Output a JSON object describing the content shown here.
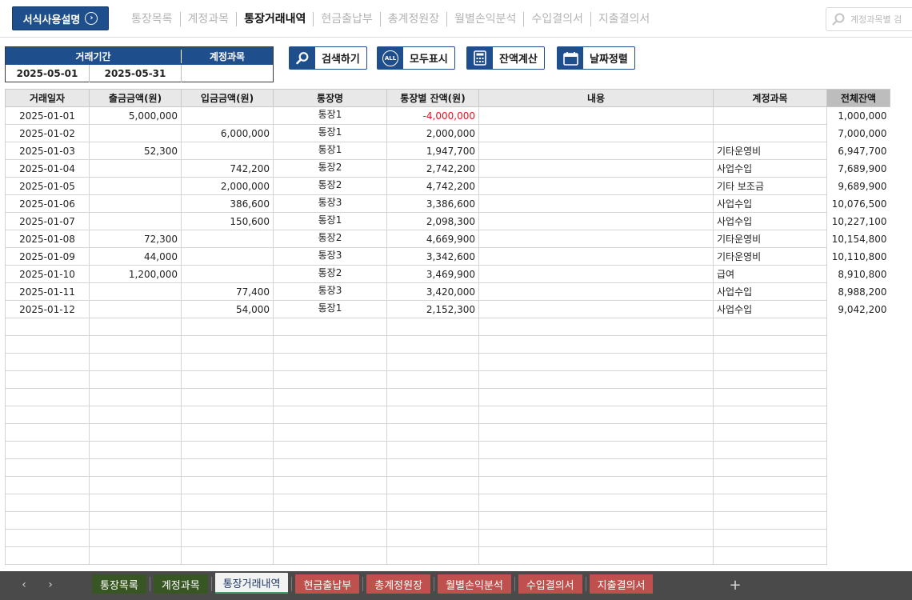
{
  "header": {
    "guide_button": "서식사용설명",
    "nav": [
      {
        "label": "통장목록",
        "active": false
      },
      {
        "label": "계정과목",
        "active": false
      },
      {
        "label": "통장거래내역",
        "active": true
      },
      {
        "label": "현금출납부",
        "active": false
      },
      {
        "label": "총계정원장",
        "active": false
      },
      {
        "label": "월별손익분석",
        "active": false
      },
      {
        "label": "수입결의서",
        "active": false
      },
      {
        "label": "지출결의서",
        "active": false
      }
    ],
    "search": {
      "placeholder": "계정과목별 검"
    }
  },
  "filter": {
    "period_label": "거래기간",
    "account_label": "계정과목",
    "start_date": "2025-05-01",
    "end_date": "2025-05-31",
    "account_value": ""
  },
  "actions": {
    "search": "검색하기",
    "show_all": "모두표시",
    "show_all_icon_text": "ALL",
    "balance": "잔액계산",
    "sort_date": "날짜정렬"
  },
  "table": {
    "columns": [
      "거래일자",
      "출금금액(원)",
      "입금금액(원)",
      "통장명",
      "통장별 잔액(원)",
      "내용",
      "계정과목",
      "전체잔액"
    ],
    "rows": [
      {
        "date": "2025-01-01",
        "out": "5,000,000",
        "in": "",
        "account": "통장1",
        "balance": "-4,000,000",
        "memo": "",
        "category": "",
        "total": "1,000,000",
        "negative": true
      },
      {
        "date": "2025-01-02",
        "out": "",
        "in": "6,000,000",
        "account": "통장1",
        "balance": "2,000,000",
        "memo": "",
        "category": "",
        "total": "7,000,000",
        "negative": false
      },
      {
        "date": "2025-01-03",
        "out": "52,300",
        "in": "",
        "account": "통장1",
        "balance": "1,947,700",
        "memo": "",
        "category": "기타운영비",
        "total": "6,947,700",
        "negative": false
      },
      {
        "date": "2025-01-04",
        "out": "",
        "in": "742,200",
        "account": "통장2",
        "balance": "2,742,200",
        "memo": "",
        "category": "사업수입",
        "total": "7,689,900",
        "negative": false
      },
      {
        "date": "2025-01-05",
        "out": "",
        "in": "2,000,000",
        "account": "통장2",
        "balance": "4,742,200",
        "memo": "",
        "category": "기타 보조금",
        "total": "9,689,900",
        "negative": false
      },
      {
        "date": "2025-01-06",
        "out": "",
        "in": "386,600",
        "account": "통장3",
        "balance": "3,386,600",
        "memo": "",
        "category": "사업수입",
        "total": "10,076,500",
        "negative": false
      },
      {
        "date": "2025-01-07",
        "out": "",
        "in": "150,600",
        "account": "통장1",
        "balance": "2,098,300",
        "memo": "",
        "category": "사업수입",
        "total": "10,227,100",
        "negative": false
      },
      {
        "date": "2025-01-08",
        "out": "72,300",
        "in": "",
        "account": "통장2",
        "balance": "4,669,900",
        "memo": "",
        "category": "기타운영비",
        "total": "10,154,800",
        "negative": false
      },
      {
        "date": "2025-01-09",
        "out": "44,000",
        "in": "",
        "account": "통장3",
        "balance": "3,342,600",
        "memo": "",
        "category": "기타운영비",
        "total": "10,110,800",
        "negative": false
      },
      {
        "date": "2025-01-10",
        "out": "1,200,000",
        "in": "",
        "account": "통장2",
        "balance": "3,469,900",
        "memo": "",
        "category": "급여",
        "total": "8,910,800",
        "negative": false
      },
      {
        "date": "2025-01-11",
        "out": "",
        "in": "77,400",
        "account": "통장3",
        "balance": "3,420,000",
        "memo": "",
        "category": "사업수입",
        "total": "8,988,200",
        "negative": false
      },
      {
        "date": "2025-01-12",
        "out": "",
        "in": "54,000",
        "account": "통장1",
        "balance": "2,152,300",
        "memo": "",
        "category": "사업수입",
        "total": "9,042,200",
        "negative": false
      }
    ],
    "blank_rows": 14
  },
  "sheet_tabs": [
    {
      "label": "통장목록",
      "color": "green",
      "active": false
    },
    {
      "label": "계정과목",
      "color": "green",
      "active": false
    },
    {
      "label": "통장거래내역",
      "color": "none",
      "active": true
    },
    {
      "label": "현금출납부",
      "color": "red",
      "active": false
    },
    {
      "label": "총계정원장",
      "color": "red",
      "active": false
    },
    {
      "label": "월별손익분석",
      "color": "red",
      "active": false
    },
    {
      "label": "수입결의서",
      "color": "red",
      "active": false
    },
    {
      "label": "지출결의서",
      "color": "red",
      "active": false
    }
  ],
  "colors": {
    "primary": "#1f4e8c",
    "negative": "#e0141e",
    "tab_green": "#375623",
    "tab_red": "#c0504d"
  }
}
